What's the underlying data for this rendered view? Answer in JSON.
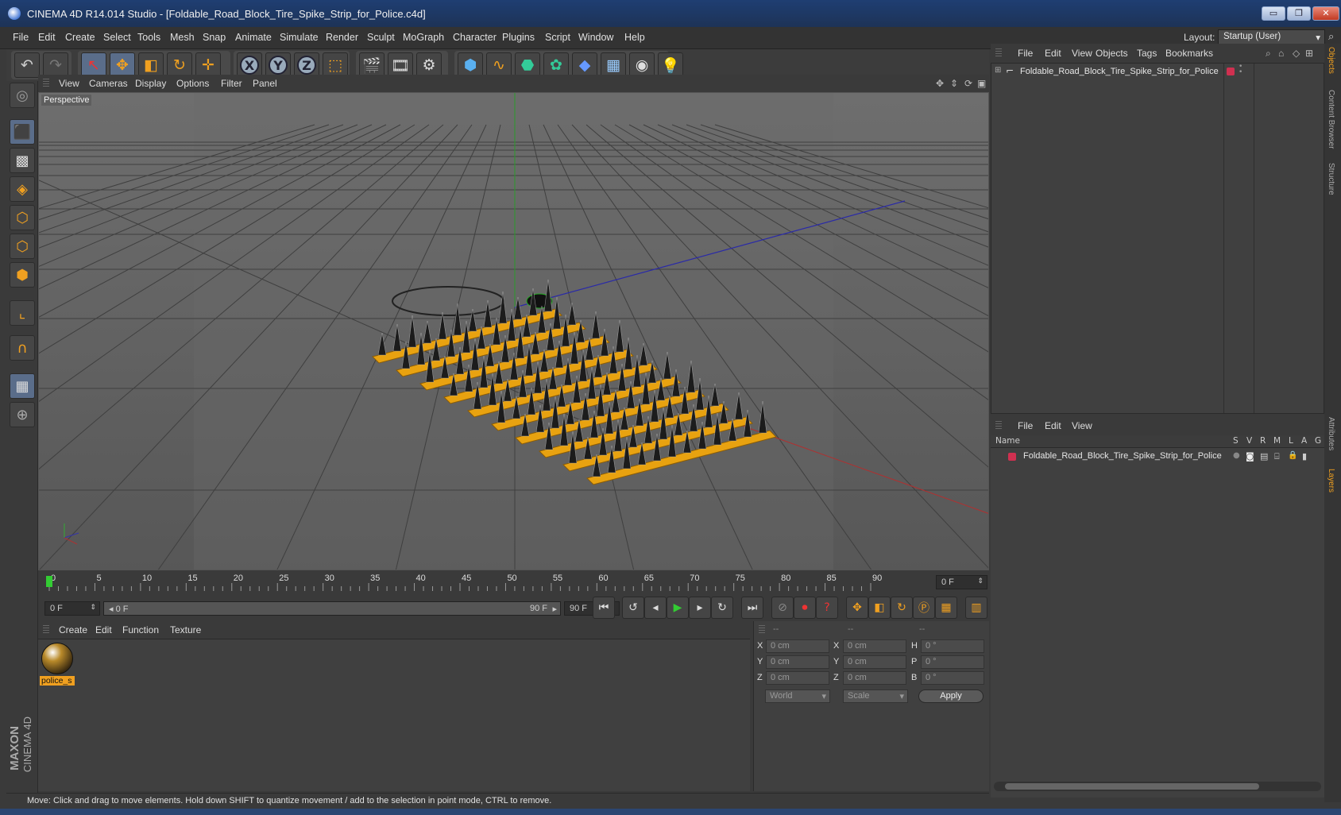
{
  "window": {
    "title": "CINEMA 4D R14.014 Studio - [Foldable_Road_Block_Tire_Spike_Strip_for_Police.c4d]",
    "buttons": [
      "▭",
      "❐",
      "✕"
    ]
  },
  "menubar": {
    "items": [
      "File",
      "Edit",
      "Create",
      "Select",
      "Tools",
      "Mesh",
      "Snap",
      "Animate",
      "Simulate",
      "Render",
      "Sculpt",
      "MoGraph",
      "Character",
      "Plugins",
      "Script",
      "Window",
      "Help"
    ],
    "layout_label": "Layout:",
    "layout_value": "Startup (User)"
  },
  "toolbar": {
    "icons": [
      "undo-icon",
      "redo-icon",
      "live-selection-icon",
      "move-icon",
      "scale-icon",
      "rotate-icon",
      "add-icon",
      "x-axis-icon",
      "y-axis-icon",
      "z-axis-icon",
      "coordinate-system-icon",
      "render-view-icon",
      "render-picture-viewer-icon",
      "edit-render-settings-icon",
      "cube-icon",
      "spline-icon",
      "nurbs-icon",
      "mograph-icon",
      "deformer-icon",
      "floor-icon",
      "camera-icon",
      "light-icon"
    ],
    "axis_labels": [
      "X",
      "Y",
      "Z"
    ]
  },
  "viewport": {
    "menu": [
      "View",
      "Cameras",
      "Display",
      "Options",
      "Filter",
      "Panel"
    ],
    "label": "Perspective"
  },
  "timeline": {
    "ticks": [
      "0",
      "5",
      "10",
      "15",
      "20",
      "25",
      "30",
      "35",
      "40",
      "45",
      "50",
      "55",
      "60",
      "65",
      "70",
      "75",
      "80",
      "85",
      "90"
    ],
    "current_frame": "0 F",
    "start_field": "0 F",
    "range_start": "0 F",
    "range_end": "90 F",
    "end_field": "90 F"
  },
  "material_manager": {
    "menu": [
      "Create",
      "Edit",
      "Function",
      "Texture"
    ],
    "materials": [
      {
        "name": "police_s"
      }
    ]
  },
  "coordinates": {
    "headers": [
      "--",
      "--",
      "--"
    ],
    "rows": [
      {
        "axis": "X",
        "pos": "0 cm",
        "axis2": "X",
        "size": "0 cm",
        "rot_axis": "H",
        "rot": "0 °"
      },
      {
        "axis": "Y",
        "pos": "0 cm",
        "axis2": "Y",
        "size": "0 cm",
        "rot_axis": "P",
        "rot": "0 °"
      },
      {
        "axis": "Z",
        "pos": "0 cm",
        "axis2": "Z",
        "size": "0 cm",
        "rot_axis": "B",
        "rot": "0 °"
      }
    ],
    "mode": "World",
    "scale": "Scale",
    "apply": "Apply"
  },
  "object_manager": {
    "menu": [
      "File",
      "Edit",
      "View",
      "Objects",
      "Tags",
      "Bookmarks"
    ],
    "object": "Foldable_Road_Block_Tire_Spike_Strip_for_Police"
  },
  "layer_manager": {
    "menu": [
      "File",
      "Edit",
      "View"
    ],
    "columns": [
      "Name",
      "S",
      "V",
      "R",
      "M",
      "L",
      "A",
      "G"
    ],
    "layer": "Foldable_Road_Block_Tire_Spike_Strip_for_Police"
  },
  "side_tabs": [
    "Objects",
    "Content Browser",
    "Structure",
    "Attributes",
    "Layers"
  ],
  "status": "Move: Click and drag to move elements. Hold down SHIFT to quantize movement / add to the selection in point mode, CTRL to remove.",
  "branding": {
    "maxon": "MAXON",
    "cinema": "CINEMA 4D"
  },
  "colors": {
    "accent": "#f0a020",
    "titlebar": "#1f3e72",
    "layer_color": "#d03050"
  }
}
